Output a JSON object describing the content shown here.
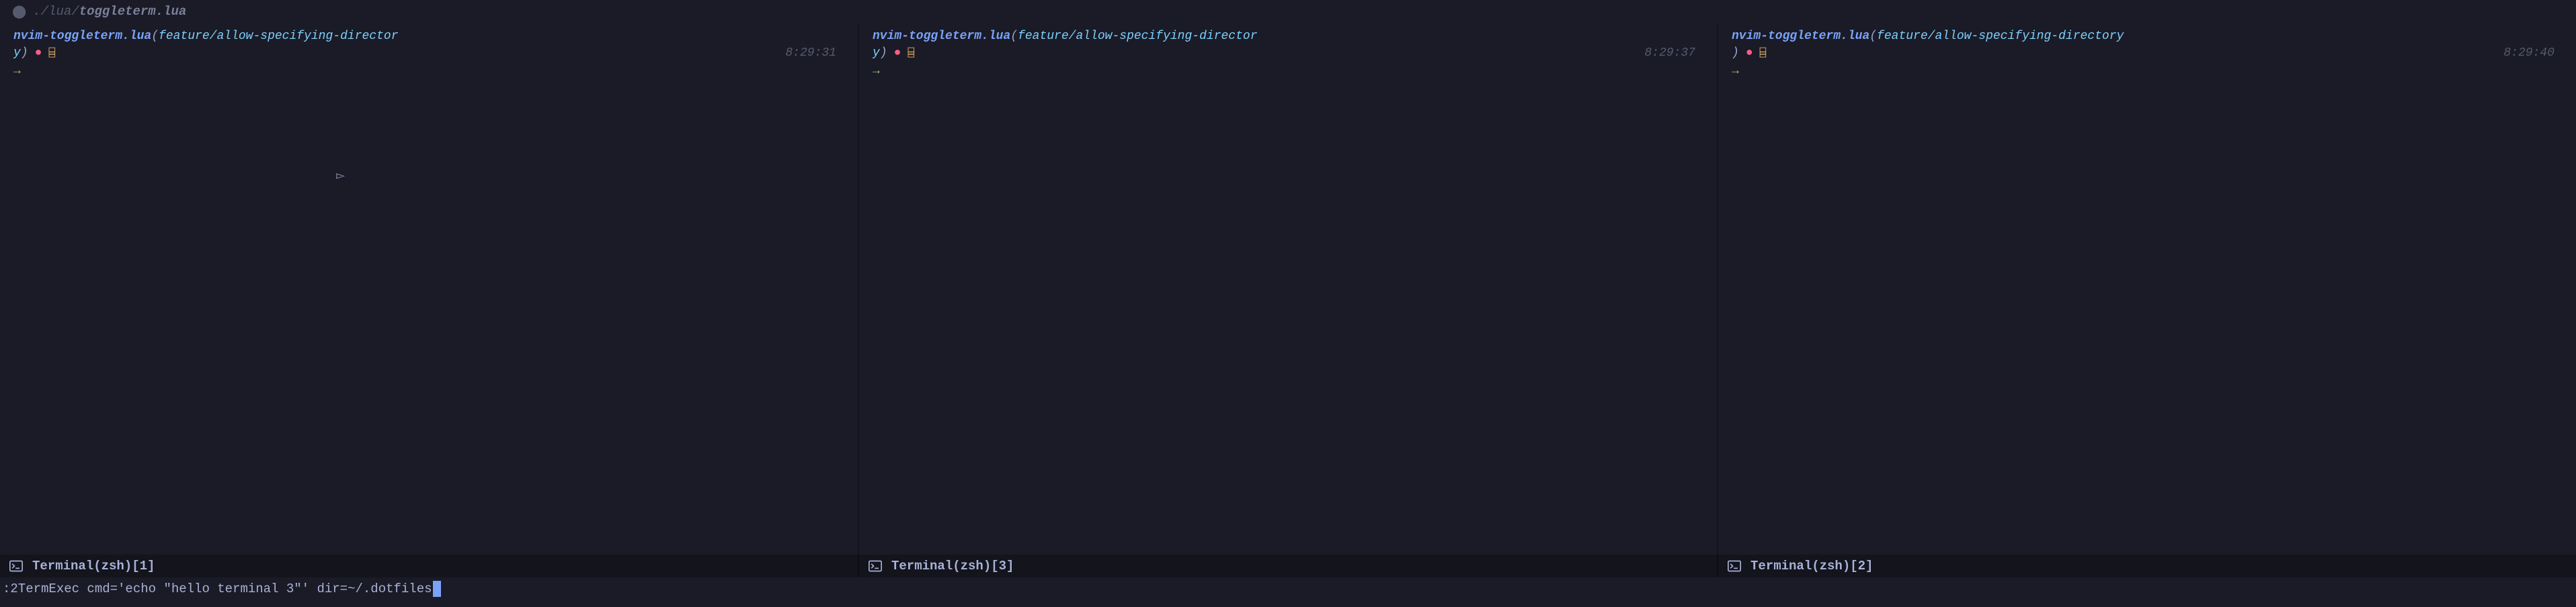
{
  "title": {
    "prefix": "./lua/",
    "file": "toggleterm.lua"
  },
  "panes": [
    {
      "project": "nvim-toggleterm.lua",
      "branch": "feature/allow-specifying-director",
      "branch_tail": "y",
      "time": "8:29:31",
      "status_label": "Terminal(zsh)[1]",
      "show_pointer": true
    },
    {
      "project": "nvim-toggleterm.lua",
      "branch": "feature/allow-specifying-director",
      "branch_tail": "y",
      "time": "8:29:37",
      "status_label": "Terminal(zsh)[3]",
      "show_pointer": false
    },
    {
      "project": "nvim-toggleterm.lua",
      "branch": "feature/allow-specifying-directory",
      "branch_tail": "",
      "time": "8:29:40",
      "status_label": "Terminal(zsh)[2]",
      "show_pointer": false
    }
  ],
  "icons": {
    "dirty": "●",
    "box": "⌸",
    "arrow": "→",
    "pointer": "▻"
  },
  "cmdline": ":2TermExec cmd='echo \"hello terminal 3\"' dir=~/.dotfiles"
}
